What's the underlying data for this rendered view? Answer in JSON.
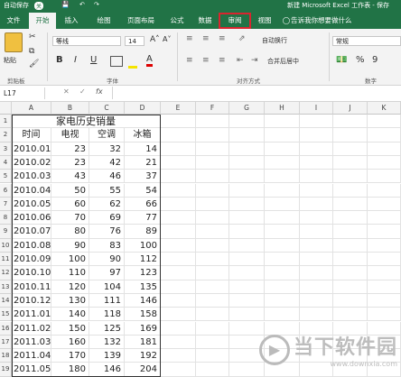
{
  "window": {
    "autosave": "自动保存",
    "autosave_state": "关",
    "title": "新建 Microsoft Excel 工作表 - 保存"
  },
  "tabs": [
    {
      "label": "文件"
    },
    {
      "label": "开始"
    },
    {
      "label": "插入"
    },
    {
      "label": "绘图"
    },
    {
      "label": "页面布局"
    },
    {
      "label": "公式"
    },
    {
      "label": "数据"
    },
    {
      "label": "审阅"
    },
    {
      "label": "视图"
    }
  ],
  "tell_me": "告诉我你想要做什么",
  "ribbon": {
    "paste": "粘贴",
    "clipboard_label": "剪贴板",
    "font_name": "等线",
    "font_size": "14",
    "font_label": "字体",
    "wrap_text": "自动换行",
    "merge_center": "合并后居中",
    "align_label": "对齐方式",
    "number_format": "常规",
    "number_label": "数字",
    "bold": "B",
    "italic": "I",
    "underline": "U"
  },
  "formula_bar": {
    "name_box": "L17",
    "fx": "fx",
    "value": ""
  },
  "grid": {
    "columns": [
      "A",
      "B",
      "C",
      "D",
      "E",
      "F",
      "G",
      "H",
      "I",
      "J",
      "K"
    ],
    "rows": [
      "1",
      "2",
      "3",
      "4",
      "5",
      "6",
      "7",
      "8",
      "9",
      "10",
      "11",
      "12",
      "13",
      "14",
      "15",
      "16",
      "17",
      "18",
      "19"
    ],
    "title": "家电历史销量",
    "headers": [
      "时间",
      "电视",
      "空调",
      "冰箱"
    ],
    "data": [
      [
        "2010.01",
        "23",
        "32",
        "14"
      ],
      [
        "2010.02",
        "23",
        "42",
        "21"
      ],
      [
        "2010.03",
        "43",
        "46",
        "37"
      ],
      [
        "2010.04",
        "50",
        "55",
        "54"
      ],
      [
        "2010.05",
        "60",
        "62",
        "66"
      ],
      [
        "2010.06",
        "70",
        "69",
        "77"
      ],
      [
        "2010.07",
        "80",
        "76",
        "89"
      ],
      [
        "2010.08",
        "90",
        "83",
        "100"
      ],
      [
        "2010.09",
        "100",
        "90",
        "112"
      ],
      [
        "2010.10",
        "110",
        "97",
        "123"
      ],
      [
        "2010.11",
        "120",
        "104",
        "135"
      ],
      [
        "2010.12",
        "130",
        "111",
        "146"
      ],
      [
        "2011.01",
        "140",
        "118",
        "158"
      ],
      [
        "2011.02",
        "150",
        "125",
        "169"
      ],
      [
        "2011.03",
        "160",
        "132",
        "181"
      ],
      [
        "2011.04",
        "170",
        "139",
        "192"
      ],
      [
        "2011.05",
        "180",
        "146",
        "204"
      ]
    ]
  },
  "watermark": {
    "name": "当下软件园",
    "url": "www.downxia.com"
  }
}
